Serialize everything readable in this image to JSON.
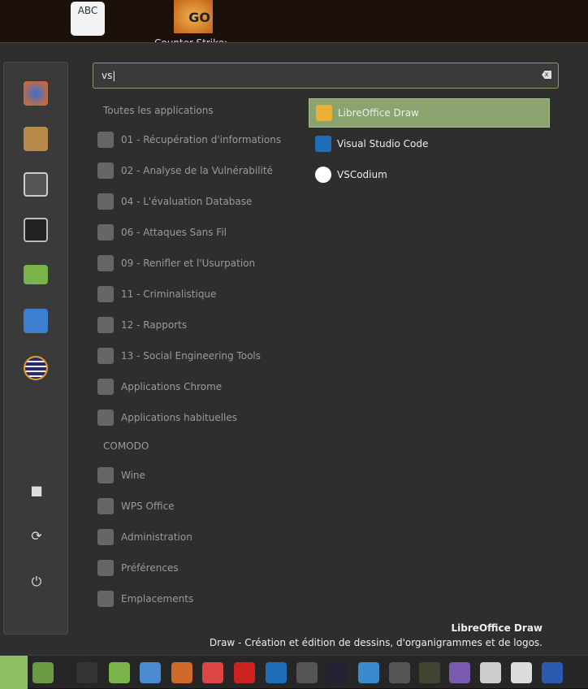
{
  "desktop": {
    "icons": [
      {
        "label": "ABC"
      },
      {
        "label": "GO",
        "caption": "Counter-Strike:"
      }
    ]
  },
  "search": {
    "value": "vs"
  },
  "categories_header": "Toutes les applications",
  "categories": [
    {
      "label": "01 - Récupération d'informations",
      "icon": "search-icon"
    },
    {
      "label": "02 - Analyse de la Vulnérabilité",
      "icon": "unlock-icon"
    },
    {
      "label": "04 - L'évaluation Database",
      "icon": "unlock-icon"
    },
    {
      "label": "06 - Attaques Sans Fil",
      "icon": "wireless-icon"
    },
    {
      "label": "09 - Renifler et l'Usurpation",
      "icon": "network-icon"
    },
    {
      "label": "11 - Criminalistique",
      "icon": "hand-icon"
    },
    {
      "label": "12 - Rapports",
      "icon": "document-icon"
    },
    {
      "label": "13 - Social Engineering Tools",
      "icon": "person-icon"
    },
    {
      "label": "Applications Chrome",
      "icon": "chrome-icon"
    },
    {
      "label": "Applications habituelles",
      "icon": "apps-icon"
    }
  ],
  "section_header": "COMODO",
  "categories2": [
    {
      "label": "Wine",
      "icon": "wine-icon"
    },
    {
      "label": "WPS Office",
      "icon": "wps-icon"
    },
    {
      "label": "Administration",
      "icon": "admin-icon"
    },
    {
      "label": "Préférences",
      "icon": "preferences-icon"
    },
    {
      "label": "Emplacements",
      "icon": "folder-icon"
    }
  ],
  "results": [
    {
      "label": "LibreOffice Draw",
      "selected": true
    },
    {
      "label": "Visual Studio Code"
    },
    {
      "label": "VSCodium"
    }
  ],
  "description": {
    "title": "LibreOffice Draw",
    "text": "Draw - Création et édition de dessins, d'organigrammes et de logos."
  },
  "colors": {
    "selected": "#8aa36f",
    "panel": "#2e2e2e"
  }
}
